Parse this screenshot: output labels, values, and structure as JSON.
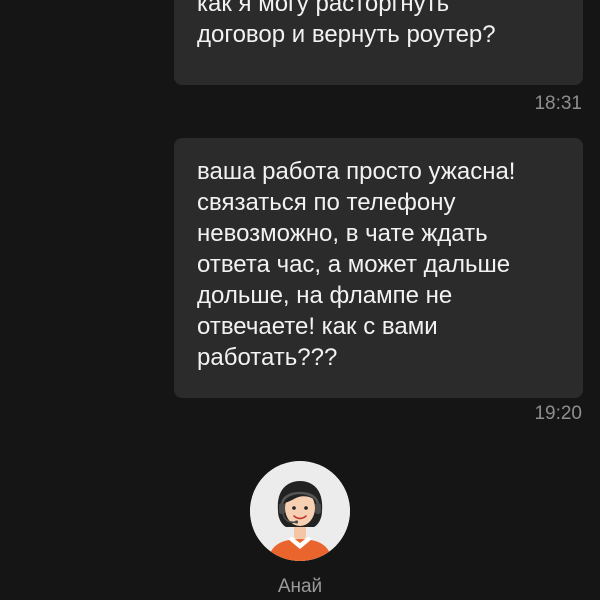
{
  "messages": [
    {
      "text": "как я могу расторгнуть\nдоговор и вернуть роутер?",
      "time": "18:31"
    },
    {
      "text": "ваша работа просто ужасна!\nсвязаться по телефону\nневозможно, в чате ждать\nответа час, а может дальше\nдольше, на флампе не\nотвечаете! как с вами\nработать???",
      "time": "19:20"
    }
  ],
  "agent": {
    "name": "Анай",
    "avatar_icon": "support-agent-avatar"
  },
  "colors": {
    "background": "#151515",
    "bubble": "#2b2b2b",
    "message_text": "#f2f2f2",
    "timestamp": "#8e8e8e",
    "agent_shirt": "#e9652d"
  }
}
